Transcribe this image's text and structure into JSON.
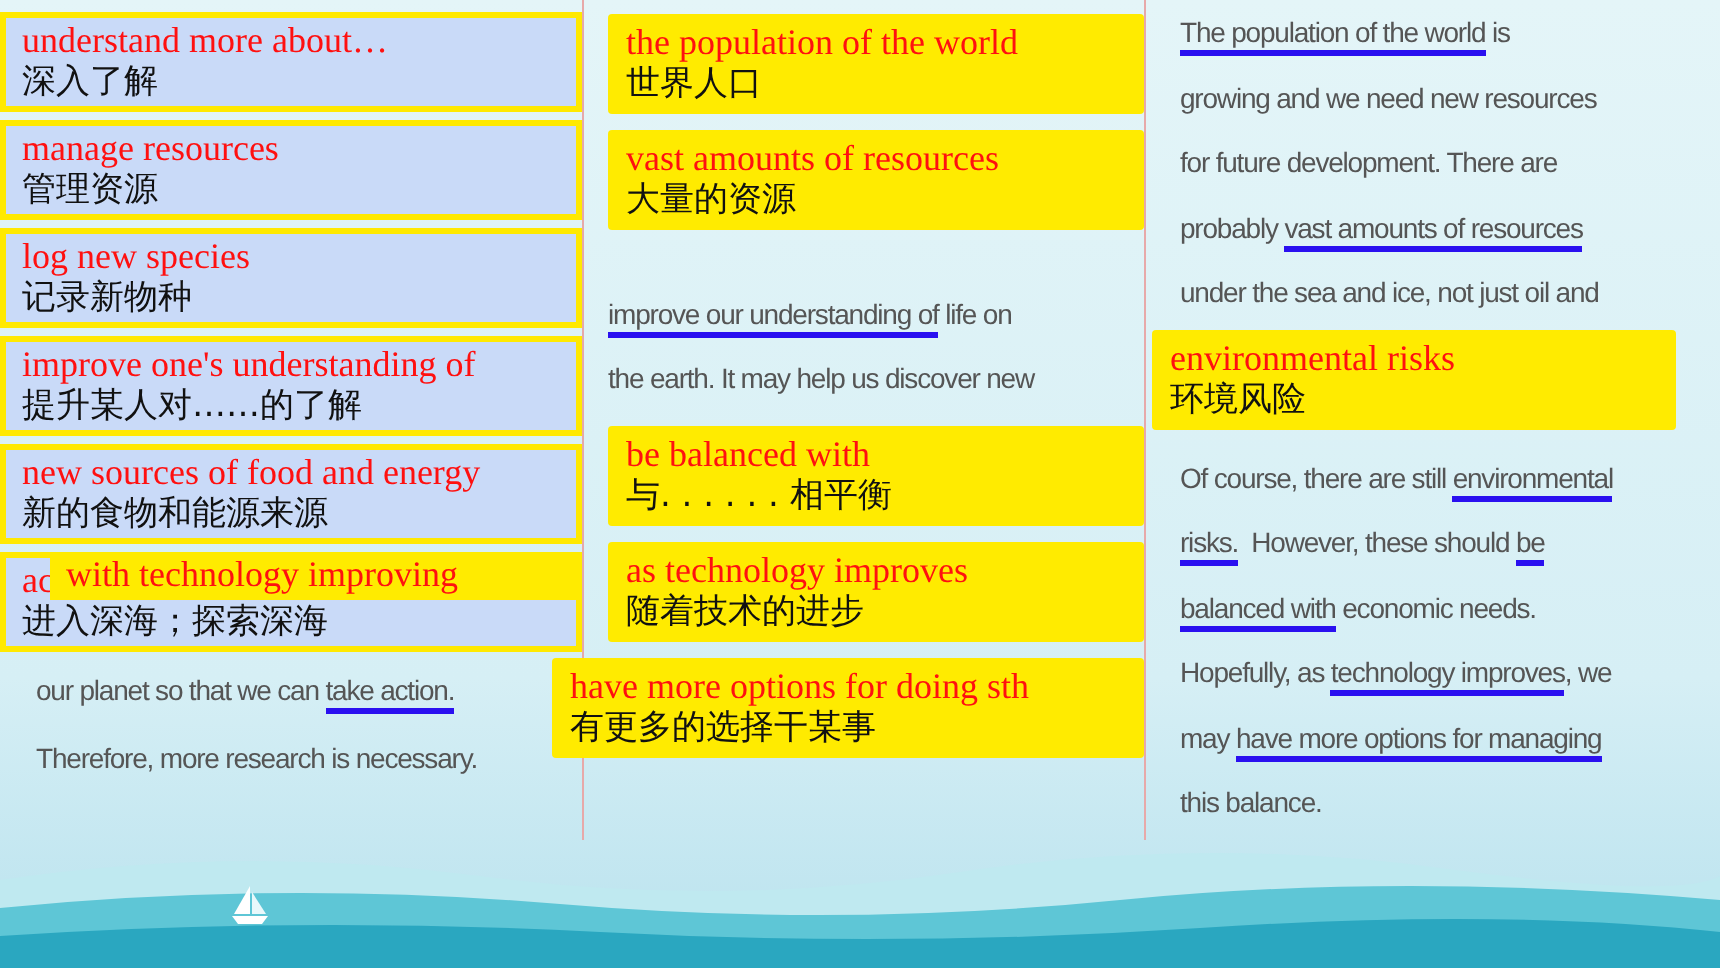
{
  "columns": [
    {
      "items": [
        {
          "kind": "framed_callout",
          "english": "understand more about…",
          "chinese": "深入了解"
        },
        {
          "kind": "framed_callout",
          "english": "manage resources",
          "chinese": "管理资源"
        },
        {
          "kind": "framed_callout",
          "english": "log new species",
          "chinese": "记录新物种"
        },
        {
          "kind": "framed_callout",
          "english": "improve one's understanding of",
          "chinese": "提升某人对……的了解"
        },
        {
          "kind": "framed_callout",
          "english": "new sources of food and energy",
          "chinese": "新的食物和能源来源"
        },
        {
          "kind": "framed_callout",
          "english": "ac",
          "chinese": "进入深海；探索深海",
          "overlay": {
            "english": "with technology improving"
          }
        },
        {
          "kind": "line",
          "segments": [
            {
              "text": "our planet so that we can ",
              "underlined": false
            },
            {
              "text": "take action.",
              "underlined": true
            }
          ]
        },
        {
          "kind": "line",
          "segments": [
            {
              "text": "Therefore, more research is necessary.",
              "underlined": false
            }
          ]
        }
      ]
    },
    {
      "items": [
        {
          "kind": "callout",
          "english": "the population of the world",
          "chinese": "世界人口"
        },
        {
          "kind": "callout",
          "english": "vast amounts of resources",
          "chinese": "大量的资源"
        },
        {
          "kind": "line",
          "segments": [
            {
              "text": "improve our understanding of",
              "underlined": true
            },
            {
              "text": " life on",
              "underlined": false
            }
          ]
        },
        {
          "kind": "line",
          "segments": [
            {
              "text": "the earth. It may help us discover new",
              "underlined": false
            }
          ]
        },
        {
          "kind": "callout",
          "english": "be balanced with",
          "chinese": "与. . . . . . 相平衡"
        },
        {
          "kind": "callout",
          "english": "as technology improves",
          "chinese": "随着技术的进步"
        },
        {
          "kind": "callout",
          "english": "have more options for doing sth",
          "chinese": "有更多的选择干某事"
        }
      ]
    },
    {
      "items": [
        {
          "kind": "line",
          "segments": [
            {
              "text": "The population of the world",
              "underlined": true
            },
            {
              "text": " is",
              "underlined": false
            }
          ]
        },
        {
          "kind": "line",
          "segments": [
            {
              "text": "growing and we need new resources",
              "underlined": false
            }
          ]
        },
        {
          "kind": "line",
          "segments": [
            {
              "text": "for future development. There are",
              "underlined": false
            }
          ]
        },
        {
          "kind": "line",
          "segments": [
            {
              "text": "probably ",
              "underlined": false
            },
            {
              "text": "vast amounts of resources",
              "underlined": true
            }
          ]
        },
        {
          "kind": "line",
          "segments": [
            {
              "text": "under the sea and ice, not just oil and",
              "underlined": false
            }
          ]
        },
        {
          "kind": "callout",
          "english": "environmental risks",
          "chinese": "环境风险"
        },
        {
          "kind": "line",
          "segments": [
            {
              "text": "Of course, there are still ",
              "underlined": false
            },
            {
              "text": "environmental",
              "underlined": true
            }
          ]
        },
        {
          "kind": "line",
          "segments": [
            {
              "text": "risks.",
              "underlined": true
            },
            {
              "text": "  However, these should ",
              "underlined": false
            },
            {
              "text": "be",
              "underlined": true
            }
          ]
        },
        {
          "kind": "line",
          "segments": [
            {
              "text": "balanced with",
              "underlined": true
            },
            {
              "text": " economic needs.",
              "underlined": false
            }
          ]
        },
        {
          "kind": "line",
          "segments": [
            {
              "text": "Hopefully, as ",
              "underlined": false
            },
            {
              "text": "technology improves",
              "underlined": true
            },
            {
              "text": ", we",
              "underlined": false
            }
          ]
        },
        {
          "kind": "line",
          "segments": [
            {
              "text": "may ",
              "underlined": false
            },
            {
              "text": "have more options for managing",
              "underlined": true
            }
          ]
        },
        {
          "kind": "line",
          "segments": [
            {
              "text": "this balance.",
              "underlined": false
            }
          ]
        }
      ]
    }
  ]
}
